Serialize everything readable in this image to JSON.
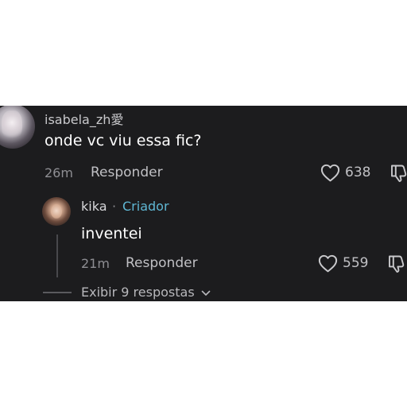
{
  "comment": {
    "username": "isabela_zh愛",
    "text": "onde vc viu essa fic?",
    "time": "26m",
    "reply_label": "Responder",
    "likes": "638"
  },
  "reply": {
    "username": "kika",
    "separator": "·",
    "badge": "Criador",
    "text": "inventei",
    "time": "21m",
    "reply_label": "Responder",
    "likes": "559"
  },
  "view_replies": {
    "label": "Exibir 9 respostas"
  },
  "colors": {
    "background": "#1c1c1e",
    "creator_badge": "#5fb7d4",
    "muted_text": "#8e8e93"
  },
  "icons": {
    "like": "heart-outline-icon",
    "dislike": "thumbs-down-outline-icon",
    "expand": "chevron-down-icon"
  }
}
